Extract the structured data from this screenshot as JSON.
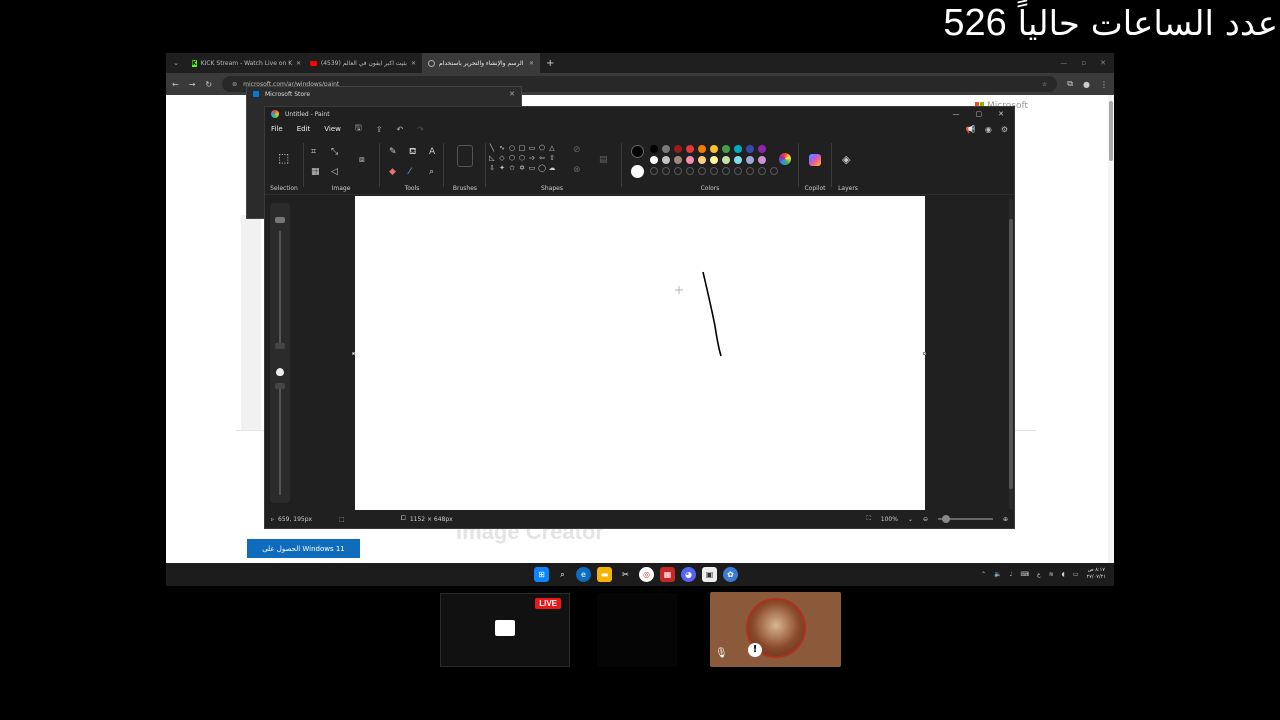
{
  "overlay": {
    "counter_label": "عدد الساعات حالياً",
    "counter_value": "526"
  },
  "browser": {
    "tabs": [
      {
        "label": "KICK Stream - Watch Live on K",
        "icon": "kick-icon",
        "active": false
      },
      {
        "label": "(4539) بثيت اكبر ايفون في العالم",
        "icon": "youtube-icon",
        "active": false
      },
      {
        "label": "الرسم والإنشاء والتحرير باستخدام",
        "icon": "globe-icon",
        "active": true
      }
    ],
    "new_tab_symbol": "+",
    "url": "microsoft.com/ar/windows/paint"
  },
  "webpage": {
    "brand": "Microsoft",
    "section_heading": "Image Creator",
    "get_button_label": "الحصول على Windows 11"
  },
  "store_window": {
    "title": "Microsoft Store"
  },
  "paint": {
    "title": "Untitled - Paint",
    "menu": [
      "File",
      "Edit",
      "View"
    ],
    "groups": {
      "selection": "Selection",
      "image": "Image",
      "tools": "Tools",
      "brushes": "Brushes",
      "shapes": "Shapes",
      "colors": "Colors",
      "copilot": "Copilot",
      "layers": "Layers"
    },
    "palette": [
      "#000000",
      "#7a7a7a",
      "#9b1c1c",
      "#e53935",
      "#f57c00",
      "#fbc02d",
      "#43a047",
      "#00acc1",
      "#3949ab",
      "#8e24aa",
      "#ffffff",
      "#c3c3c3",
      "#a1887f",
      "#f48fb1",
      "#ffcc80",
      "#fff59d",
      "#c5e1a5",
      "#80deea",
      "#9fa8da",
      "#ce93d8"
    ],
    "status": {
      "cursor_pos": "659, 195px",
      "canvas_size": "1152 × 648px",
      "zoom": "100%"
    }
  },
  "taskbar": {
    "clock_time": "٨:١٧ ص",
    "clock_date": "٢٧/٠٧/٢١",
    "lang": "ع"
  },
  "stream": {
    "live_badge": "LIVE"
  }
}
